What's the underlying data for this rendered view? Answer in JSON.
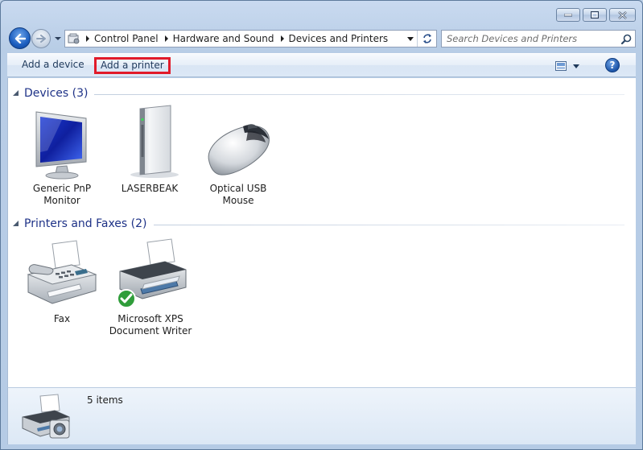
{
  "window": {
    "caption": {
      "minimize": "minimize",
      "maximize": "maximize",
      "close": "close"
    }
  },
  "breadcrumb": [
    {
      "label": "Control Panel"
    },
    {
      "label": "Hardware and Sound"
    },
    {
      "label": "Devices and Printers"
    }
  ],
  "search": {
    "placeholder": "Search Devices and Printers"
  },
  "toolbar": {
    "add_device": "Add a device",
    "add_printer": "Add a printer",
    "help": "?"
  },
  "groups": {
    "devices": {
      "title": "Devices (3)",
      "items": [
        {
          "label_line1": "Generic PnP",
          "label_line2": "Monitor",
          "icon": "monitor-icon"
        },
        {
          "label_line1": "LASERBEAK",
          "label_line2": "",
          "icon": "computer-tower-icon"
        },
        {
          "label_line1": "Optical USB",
          "label_line2": "Mouse",
          "icon": "mouse-icon"
        }
      ]
    },
    "printers": {
      "title": "Printers and Faxes (2)",
      "items": [
        {
          "label_line1": "Fax",
          "label_line2": "",
          "icon": "fax-icon"
        },
        {
          "label_line1": "Microsoft XPS",
          "label_line2": "Document Writer",
          "icon": "printer-icon",
          "default": true
        }
      ]
    }
  },
  "details": {
    "count": "5 items"
  },
  "colors": {
    "highlight": "#e11b2a",
    "group_title": "#1e3287",
    "command_text": "#1e395b"
  }
}
